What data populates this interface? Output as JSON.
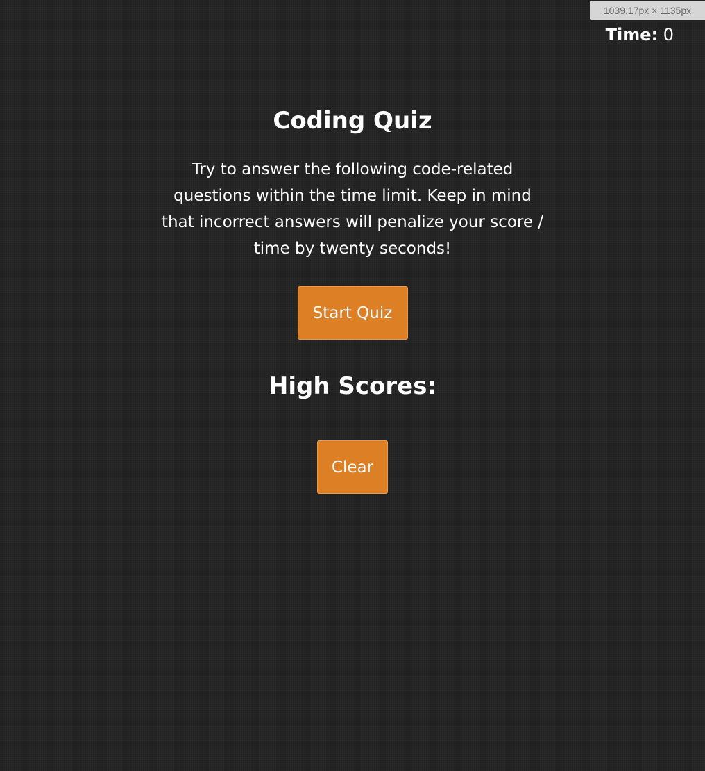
{
  "devtools": {
    "dimensions_label": "1039.17px × 1135px"
  },
  "timer": {
    "label": "Time:",
    "value": "0"
  },
  "quiz": {
    "title": "Coding Quiz",
    "intro": "Try to answer the following code-related questions within the time limit. Keep in mind that incorrect answers will penalize your score / time by twenty seconds!",
    "start_label": "Start Quiz"
  },
  "high_scores": {
    "title": "High Scores:",
    "entries": [],
    "clear_label": "Clear"
  },
  "colors": {
    "background": "#222222",
    "accent": "#dd7f25",
    "text": "#ffffff"
  }
}
